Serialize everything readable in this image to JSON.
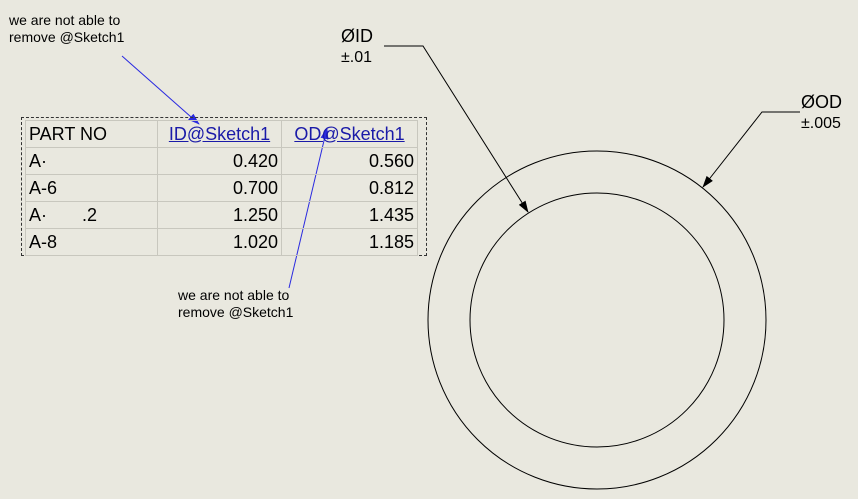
{
  "notes": {
    "top": [
      "we are not able to",
      "remove @Sketch1"
    ],
    "bottom": [
      "we are not able to",
      "remove @Sketch1"
    ]
  },
  "design_table": {
    "headers": [
      "PART NO",
      "ID@Sketch1",
      "OD@Sketch1"
    ],
    "rows": [
      [
        "A·",
        "0.420",
        "0.560"
      ],
      [
        "A-6",
        "0.700",
        "0.812"
      ],
      [
        "A·       .2",
        "1.250",
        "1.435"
      ],
      [
        "A-8",
        "1.020",
        "1.185"
      ]
    ]
  },
  "dimensions": {
    "id": {
      "label": "ØID",
      "tolerance": "±.01"
    },
    "od": {
      "label": "ØOD",
      "tolerance": "±.005"
    }
  },
  "colors": {
    "background": "#e9e8df",
    "leader_blue": "#2a2ae0",
    "header_link": "#1a1aa8"
  }
}
